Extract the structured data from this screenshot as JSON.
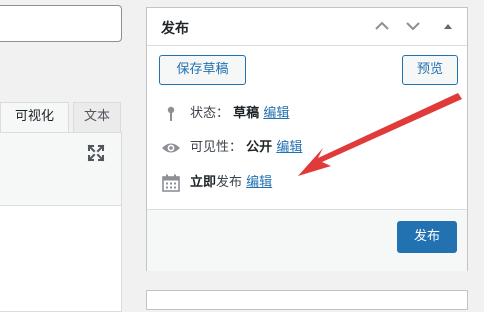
{
  "editor": {
    "tabs": [
      {
        "label": "可视化"
      },
      {
        "label": "文本"
      }
    ]
  },
  "publish": {
    "title": "发布",
    "save_draft": "保存草稿",
    "preview": "预览",
    "status": {
      "label": "状态：",
      "value": "草稿",
      "edit": "编辑"
    },
    "visibility": {
      "label": "可见性：",
      "value": "公开",
      "edit": "编辑"
    },
    "schedule": {
      "label_bold": "立即",
      "label": "发布",
      "edit": "编辑"
    },
    "publish_button": "发布"
  },
  "icons": {
    "collapse_up": "chevron-up-icon",
    "collapse_down": "chevron-down-icon",
    "toggle": "triangle-up-icon",
    "fullscreen": "fullscreen-icon",
    "status": "pin-icon",
    "visibility": "eye-icon",
    "schedule": "calendar-icon"
  },
  "colors": {
    "accent": "#2271b1",
    "annotation": "#e03a3a"
  }
}
